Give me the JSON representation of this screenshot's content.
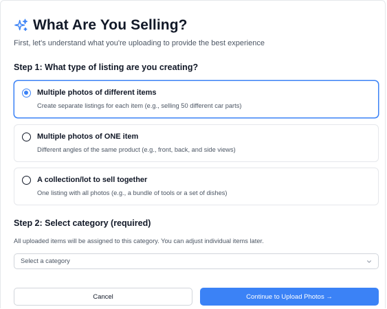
{
  "header": {
    "title": "What Are You Selling?",
    "subtitle": "First, let's understand what you're uploading to provide the best experience",
    "icon": "sparkle-icon"
  },
  "step1": {
    "heading": "Step 1: What type of listing are you creating?",
    "options": [
      {
        "title": "Multiple photos of different items",
        "description": "Create separate listings for each item (e.g., selling 50 different car parts)",
        "selected": true
      },
      {
        "title": "Multiple photos of ONE item",
        "description": "Different angles of the same product (e.g., front, back, and side views)",
        "selected": false
      },
      {
        "title": "A collection/lot to sell together",
        "description": "One listing with all photos (e.g., a bundle of tools or a set of dishes)",
        "selected": false
      }
    ]
  },
  "step2": {
    "heading": "Step 2: Select category (required)",
    "help": "All uploaded items will be assigned to this category. You can adjust individual items later.",
    "select_value": "Select a category"
  },
  "actions": {
    "cancel_label": "Cancel",
    "continue_label": "Continue to Upload Photos →"
  },
  "colors": {
    "accent": "#3b82f6",
    "text": "#111827",
    "muted": "#4b5563",
    "border": "#e5e7eb"
  }
}
